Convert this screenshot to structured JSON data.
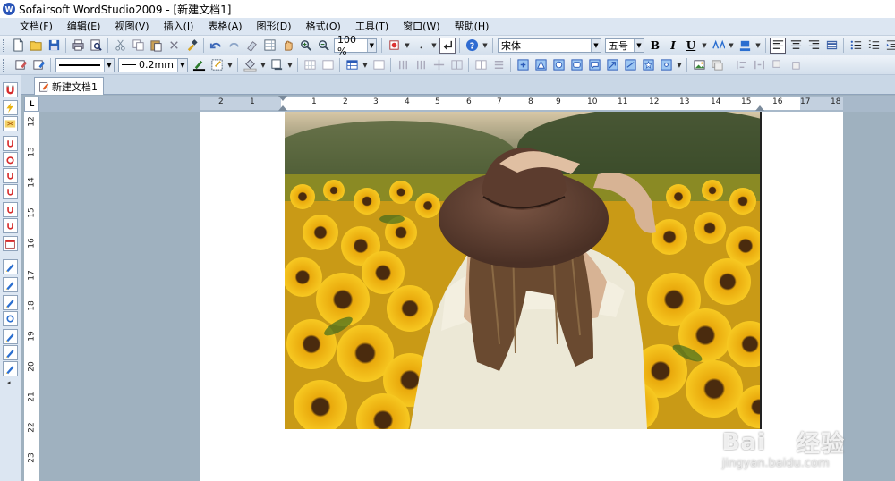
{
  "titlebar": {
    "logo": "W",
    "title": "Sofairsoft WordStudio2009 - [新建文档1]"
  },
  "menu": [
    "文档(F)",
    "编辑(E)",
    "视图(V)",
    "插入(I)",
    "表格(A)",
    "图形(D)",
    "格式(O)",
    "工具(T)",
    "窗口(W)",
    "帮助(H)"
  ],
  "toolbar1": {
    "zoom": "100 %",
    "font_name": "宋体",
    "font_size": "五号",
    "bold": "B",
    "italic": "I",
    "underline": "U"
  },
  "toolbar2": {
    "line_width": "0.2mm"
  },
  "tabs": [
    {
      "label": "新建文档1"
    }
  ],
  "ruler": {
    "corner": "L",
    "horizontal_labels": [
      "2",
      "1",
      "1",
      "2",
      "3",
      "4",
      "5",
      "6",
      "7",
      "8",
      "9",
      "10",
      "11",
      "12",
      "13",
      "14",
      "15",
      "16",
      "17",
      "18"
    ],
    "vertical_labels": [
      "12",
      "13",
      "14",
      "15",
      "16",
      "17",
      "18",
      "19",
      "20",
      "21",
      "22",
      "23"
    ]
  },
  "watermark": {
    "brand_left": "Bai",
    "brand_right": "经验",
    "url": "jingyan.baidu.com"
  },
  "colors": {
    "menu_bg": "#dce6f2",
    "workspace": "#9fb1bf",
    "accent": "#2a55b8"
  },
  "icons": {
    "app": "wordstudio-logo-icon",
    "document_tab": "document-edit-icon"
  }
}
